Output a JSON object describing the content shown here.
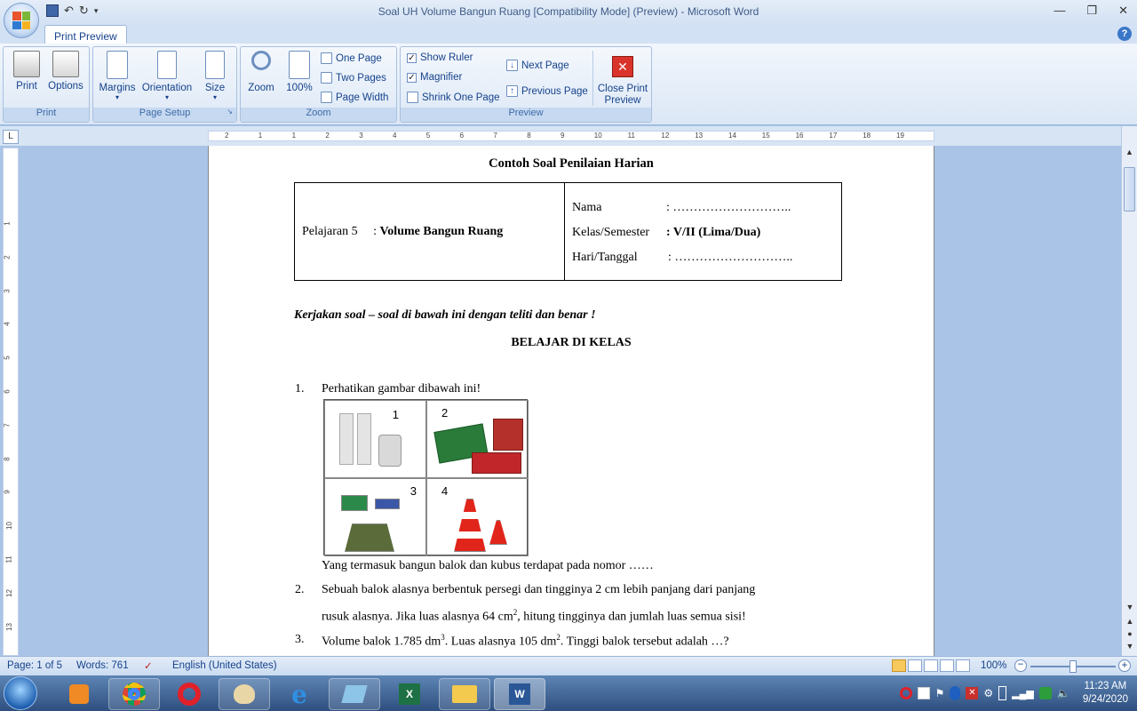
{
  "window": {
    "title": "Soal UH Volume Bangun Ruang [Compatibility Mode] (Preview) - Microsoft Word",
    "controls": [
      "—",
      "❐",
      "✕"
    ]
  },
  "ribbon": {
    "tab": "Print Preview",
    "groups": {
      "print": {
        "label": "Print",
        "print_btn": "Print",
        "options_btn": "Options"
      },
      "page_setup": {
        "label": "Page Setup",
        "margins_btn": "Margins",
        "orientation_btn": "Orientation",
        "size_btn": "Size"
      },
      "zoom": {
        "label": "Zoom",
        "zoom_btn": "Zoom",
        "hundred_btn": "100%",
        "one_page": "One Page",
        "two_pages": "Two Pages",
        "page_width": "Page Width"
      },
      "preview": {
        "label": "Preview",
        "show_ruler": "Show Ruler",
        "magnifier": "Magnifier",
        "shrink_one_page": "Shrink One Page",
        "next_page": "Next Page",
        "previous_page": "Previous Page",
        "close_line1": "Close Print",
        "close_line2": "Preview"
      }
    }
  },
  "ruler": {
    "corner": "L",
    "h_ticks": [
      "2",
      "1",
      "1",
      "2",
      "3",
      "4",
      "5",
      "6",
      "7",
      "8",
      "9",
      "10",
      "11",
      "12",
      "13",
      "14",
      "15",
      "16",
      "17",
      "18",
      "19"
    ],
    "v_ticks": [
      "1",
      "2",
      "3",
      "4",
      "5",
      "6",
      "7",
      "8",
      "9",
      "10",
      "11",
      "12",
      "13",
      "14"
    ]
  },
  "document": {
    "heading": "Contoh Soal Penilaian Harian",
    "table": {
      "pelajaran_label": "Pelajaran 5",
      "pelajaran_sep": ":",
      "pelajaran_value": "Volume Bangun Ruang",
      "nama_label": "Nama",
      "nama_value": ": ………………………..",
      "kelas_label": "Kelas/Semester",
      "kelas_value": ": V/II (Lima/Dua)",
      "hari_label": "Hari/Tanggal",
      "hari_value": ": ……………………….."
    },
    "instruction": "Kerjakan soal – soal di bawah ini dengan teliti dan benar !",
    "section_title": "BELAJAR DI KELAS",
    "q1_num": "1.",
    "q1_text": "Perhatikan gambar dibawah ini!",
    "pic_numbers": [
      "1",
      "2",
      "3",
      "4"
    ],
    "q1_follow": "Yang termasuk bangun balok dan kubus terdapat pada nomor ……",
    "q2_num": "2.",
    "q2_line1": "Sebuah balok alasnya berbentuk persegi dan tingginya 2 cm lebih panjang dari panjang",
    "q2_line2a": "rusuk alasnya. Jika luas alasnya 64 cm",
    "q2_sup": "2",
    "q2_line2b": ", hitung tingginya dan jumlah luas semua sisi!",
    "q3_num": "3.",
    "q3_a": "Volume balok 1.785 dm",
    "q3_sup1": "3",
    "q3_b": ". Luas alasnya 105 dm",
    "q3_sup2": "2",
    "q3_c": ". Tinggi balok tersebut adalah …?"
  },
  "status": {
    "page": "Page: 1 of 5",
    "words": "Words: 761",
    "language": "English (United States)",
    "zoom": "100%",
    "zoom_level_percent": 100
  },
  "taskbar": {
    "time": "11:23 AM",
    "date": "9/24/2020"
  },
  "colors": {
    "ribbon_text": "#15428b",
    "app_bg": "#a9c4e6",
    "close_preview_red": "#d9342b"
  }
}
